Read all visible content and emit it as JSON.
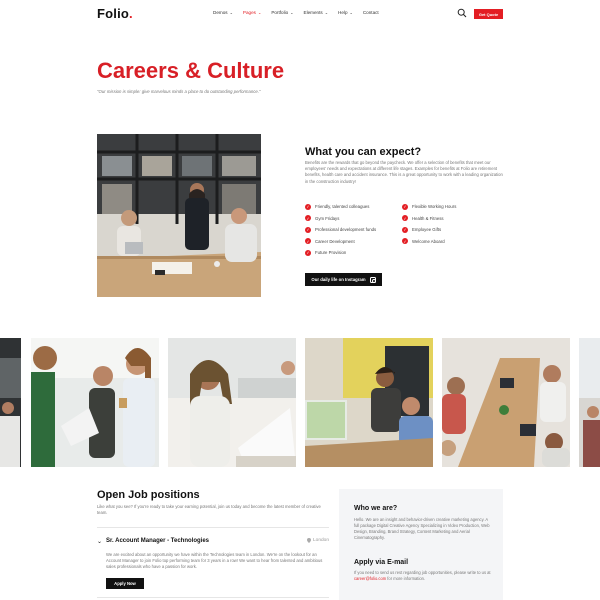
{
  "header": {
    "logo_text": "Folio",
    "logo_dot": ".",
    "nav": [
      {
        "label": "Demos",
        "active": false
      },
      {
        "label": "Pages",
        "active": true
      },
      {
        "label": "Portfolio",
        "active": false
      },
      {
        "label": "Elements",
        "active": false
      },
      {
        "label": "Help",
        "active": false
      },
      {
        "label": "Contact",
        "active": false
      }
    ],
    "search_icon": "search-icon",
    "quote_label": "Get Quote"
  },
  "hero": {
    "title": "Careers & Culture",
    "subtitle": "\"Our mission is simple: give marvelous minds a place to do outstanding performance.\""
  },
  "expect": {
    "title": "What you can expect?",
    "text": "Benefits are the rewards that go beyond the paycheck. We offer a selection of benefits that meet our employees' needs and expectations at different life stages. Examples for benefits at Folio are retirement benefits, health care and accident insurance. This is a great opportunity to work with a leading organization in the construction industry!",
    "benefits": [
      "Friendly, talented colleagues",
      "Flexible Working Hours",
      "Gym Fridays",
      "Health & Fitness",
      "Professional development funds",
      "Employee Gifts",
      "Career Development",
      "Welcome Aboard",
      "Future Provision"
    ],
    "instagram_button": "Our daily life on Instagram"
  },
  "jobs": {
    "title": "Open Job positions",
    "text": "Like what you see? If you're ready to take your earning potential, join us today and become the latest member of creative team.",
    "position": {
      "name": "Sr. Account Manager - Technologies",
      "location": "London",
      "description": "We are excited about an opportunity we have within the Technologies team in London. We're on the lookout for an Account Manager to join Folio top performing team for 3 years in a row! We want to hear from talented and ambitious sales professionals who have a passion for work.",
      "apply_label": "Apply Now"
    }
  },
  "who": {
    "title": "Who we are?",
    "text": "Hello. We are an insight and behavior-driven creative marketing agency. A full package Digital Creative Agency Specializing in Video Production, Web Design, Branding, Brand Strategy, Content Marketing and Aerial Cinematography.",
    "apply_title": "Apply via E-mail",
    "apply_text_before": "If you need to send us rest regarding job opportunities, please write to us at ",
    "apply_email": "career@folio.com",
    "apply_text_after": " for more information."
  },
  "colors": {
    "accent": "#e31e24",
    "dark": "#111111",
    "panel": "#f4f5f7"
  }
}
